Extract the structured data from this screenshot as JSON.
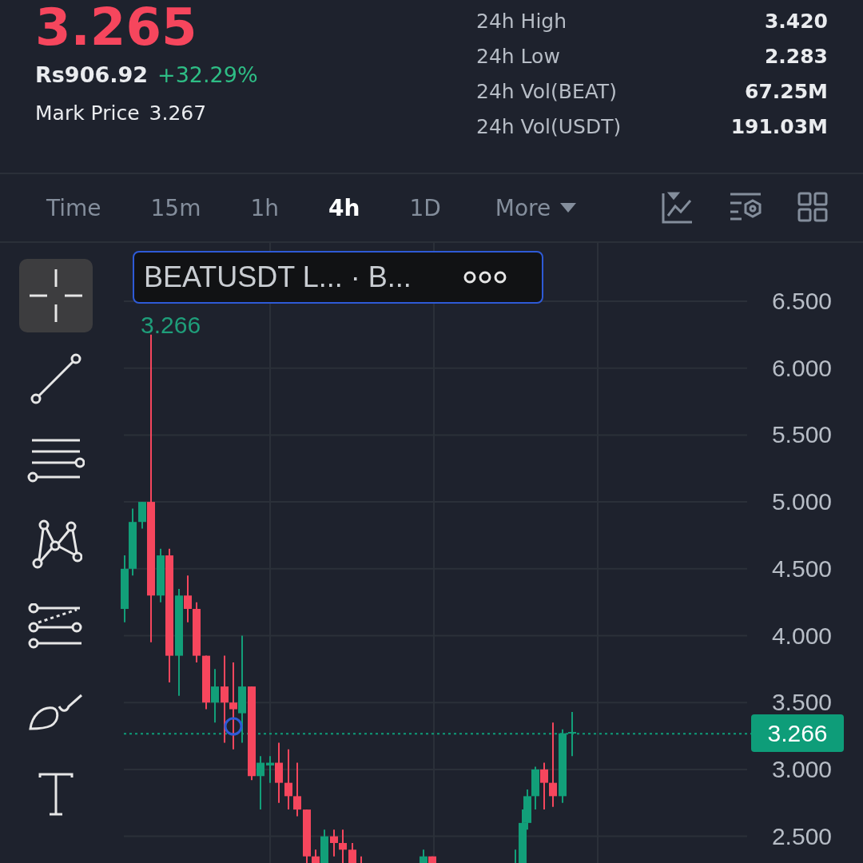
{
  "header": {
    "last_price": "3.265",
    "fiat_price": "Rs906.92",
    "change": "+32.29%",
    "mark_price_label": "Mark Price",
    "mark_price": "3.267"
  },
  "stats": [
    {
      "label": "24h High",
      "value": "3.420"
    },
    {
      "label": "24h Low",
      "value": "2.283"
    },
    {
      "label": "24h Vol(BEAT)",
      "value": "67.25M"
    },
    {
      "label": "24h Vol(USDT)",
      "value": "191.03M"
    }
  ],
  "intervals": [
    {
      "label": "Time",
      "selected": false
    },
    {
      "label": "15m",
      "selected": false
    },
    {
      "label": "1h",
      "selected": false
    },
    {
      "label": "4h",
      "selected": true
    },
    {
      "label": "1D",
      "selected": false
    }
  ],
  "more": {
    "label": "More"
  },
  "drawing_tools": [
    {
      "kind": "crosshair",
      "selected": true
    },
    {
      "kind": "line",
      "selected": false
    },
    {
      "kind": "parallel",
      "selected": false
    },
    {
      "kind": "pattern",
      "selected": false
    },
    {
      "kind": "fib",
      "selected": false
    },
    {
      "kind": "brush",
      "selected": false
    },
    {
      "kind": "text",
      "selected": false
    }
  ],
  "legend": {
    "title": "BEATUSDT L... · B...",
    "last_value": "3.266"
  },
  "price_axis": [
    "6.500",
    "6.000",
    "5.500",
    "5.000",
    "4.500",
    "4.000",
    "3.500",
    "3.000",
    "2.500"
  ],
  "current_price": "3.266"
}
